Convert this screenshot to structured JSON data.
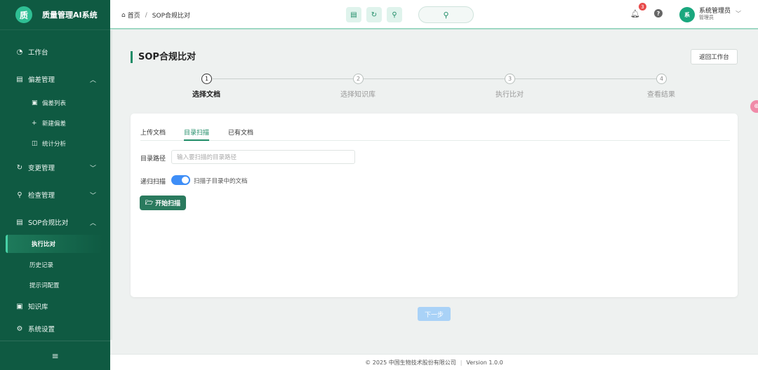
{
  "app": {
    "logo_glyph": "质",
    "title": "质量管理AI系统"
  },
  "sidebar": {
    "workbench": "工作台",
    "deviation": {
      "label": "偏差管理",
      "children": [
        "偏差列表",
        "新建偏差",
        "统计分析"
      ]
    },
    "change": "变更管理",
    "inspection": "检查管理",
    "sop": {
      "label": "SOP合规比对",
      "children": [
        "执行比对",
        "历史记录",
        "提示词配置"
      ]
    },
    "knowledge": "知识库",
    "settings": "系统设置",
    "collapse_glyph": "≡"
  },
  "header": {
    "breadcrumb": {
      "home": "首页",
      "current": "SOP合规比对"
    },
    "notification_count": "3",
    "avatar_text": "系",
    "user_name": "系统管理员",
    "user_role": "管理员"
  },
  "page": {
    "title": "SOP合规比对",
    "back_button": "返回工作台",
    "steps": [
      {
        "num": "1",
        "label": "选择文档"
      },
      {
        "num": "2",
        "label": "选择知识库"
      },
      {
        "num": "3",
        "label": "执行比对"
      },
      {
        "num": "4",
        "label": "查看结果"
      }
    ],
    "active_step": 1,
    "tabs": [
      "上传文档",
      "目录扫描",
      "已有文档"
    ],
    "active_tab": "目录扫描",
    "dir_path_label": "目录路径",
    "dir_path_placeholder": "输入要扫描的目录路径",
    "recursive_label": "递归扫描",
    "recursive_on": true,
    "recursive_desc": "扫描子目录中的文档",
    "start_scan": "开始扫描",
    "next_step": "下一步"
  },
  "footer": {
    "copyright": "© 2025 中国生物技术股份有限公司",
    "version": "Version 1.0.0"
  },
  "colors": {
    "sidebar_bg": "#0f5a42",
    "accent": "#1f8c67",
    "toggle_on": "#3e8ef7",
    "badge": "#e84b4b",
    "next_disabled": "#a9d2f7"
  }
}
